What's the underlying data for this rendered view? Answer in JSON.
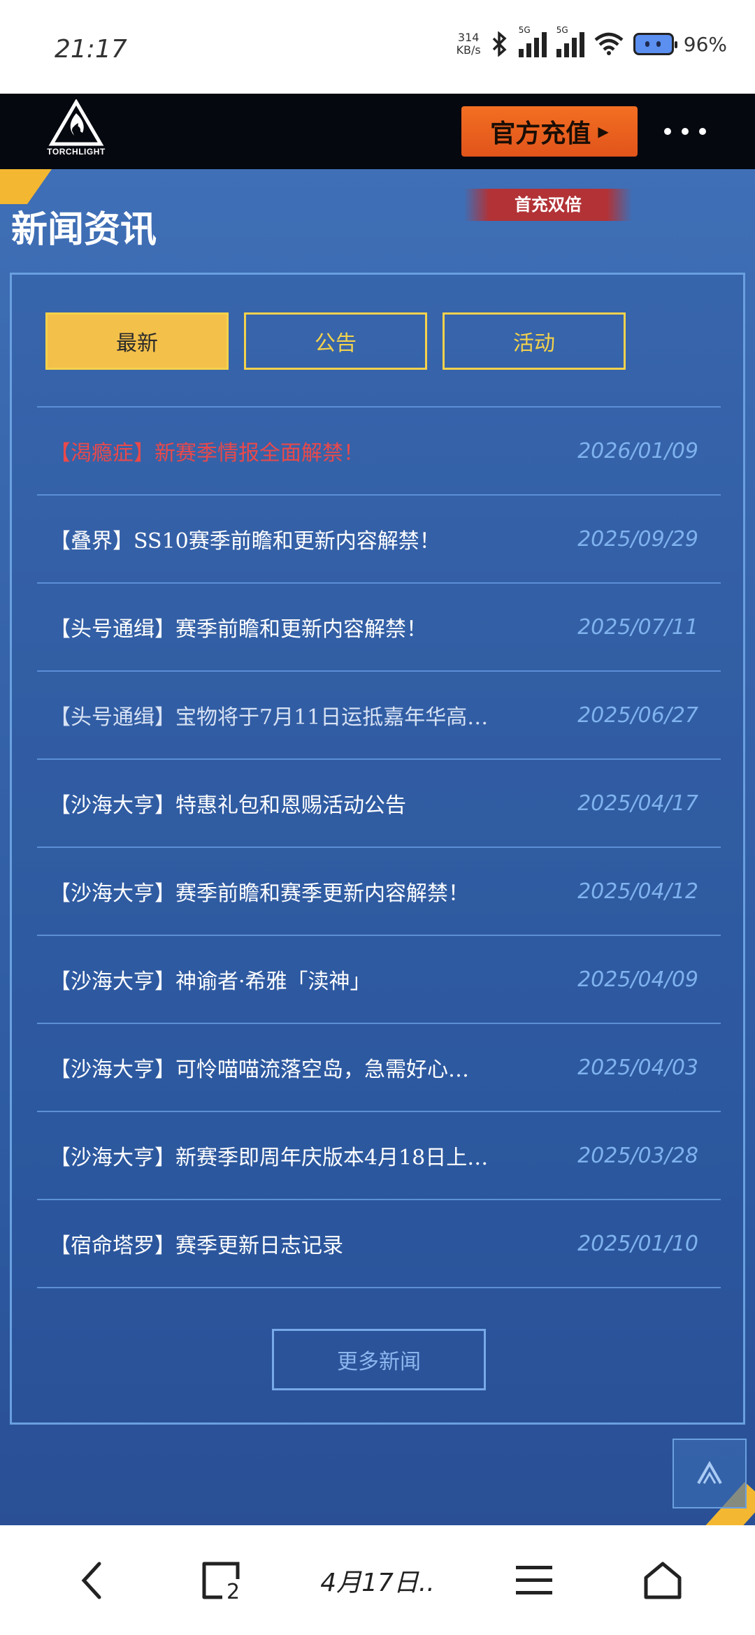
{
  "status_bar": {
    "time": "21:17",
    "net_speed_value": "314",
    "net_speed_unit": "KB/s",
    "signal1_tag": "5G",
    "signal2_tag": "5G",
    "battery_percent": "96%"
  },
  "header": {
    "logo_text": "TORCHLIGHT",
    "recharge_label": "官方充值",
    "badge_label": "首充双倍"
  },
  "section": {
    "title": "新闻资讯"
  },
  "tabs": [
    {
      "label": "最新",
      "active": true
    },
    {
      "label": "公告",
      "active": false
    },
    {
      "label": "活动",
      "active": false
    }
  ],
  "news": [
    {
      "title": "【渴瘾症】新赛季情报全面解禁！",
      "date": "2026/01/09",
      "style": "hot"
    },
    {
      "title": "【叠界】SS10赛季前瞻和更新内容解禁！",
      "date": "2025/09/29",
      "style": "normal"
    },
    {
      "title": "【头号通缉】赛季前瞻和更新内容解禁！",
      "date": "2025/07/11",
      "style": "normal"
    },
    {
      "title": "【头号通缉】宝物将于7月11日运抵嘉年华高…",
      "date": "2025/06/27",
      "style": "dim"
    },
    {
      "title": "【沙海大亨】特惠礼包和恩赐活动公告",
      "date": "2025/04/17",
      "style": "normal"
    },
    {
      "title": "【沙海大亨】赛季前瞻和赛季更新内容解禁！",
      "date": "2025/04/12",
      "style": "normal"
    },
    {
      "title": "【沙海大亨】神谕者·希雅「渎神」",
      "date": "2025/04/09",
      "style": "normal"
    },
    {
      "title": "【沙海大亨】可怜喵喵流落空岛，急需好心…",
      "date": "2025/04/03",
      "style": "normal"
    },
    {
      "title": "【沙海大亨】新赛季即周年庆版本4月18日上…",
      "date": "2025/03/28",
      "style": "normal"
    },
    {
      "title": "【宿命塔罗】赛季更新日志记录",
      "date": "2025/01/10",
      "style": "normal"
    }
  ],
  "more_news_label": "更多新闻",
  "bottom_nav": {
    "tab_count": "2",
    "date_label": "4月17日.."
  },
  "colors": {
    "accent_yellow": "#f3c04a",
    "recharge_orange": "#e86020",
    "hot_red": "#e9494b",
    "date_blue": "#7fb2ee"
  }
}
